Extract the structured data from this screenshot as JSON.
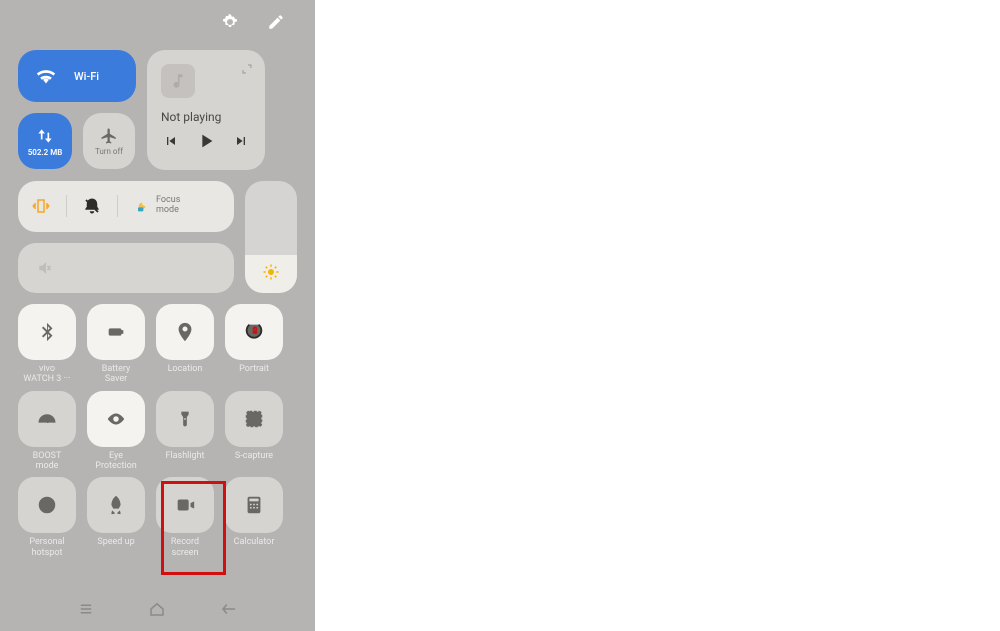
{
  "topbar": {
    "settings_icon": "settings",
    "edit_icon": "edit"
  },
  "wifi": {
    "label": "Wi-Fi"
  },
  "data": {
    "usage": "502.2 MB"
  },
  "airplane": {
    "label": "Turn off"
  },
  "media": {
    "status": "Not playing"
  },
  "modes": {
    "focus_label": "Focus\nmode"
  },
  "tiles": {
    "bluetooth": {
      "label": "vivo\nWATCH 3 ···"
    },
    "battery": {
      "label": "Battery\nSaver"
    },
    "location": {
      "label": "Location"
    },
    "portrait": {
      "label": "Portrait"
    },
    "boost": {
      "label": "BOOST\nmode"
    },
    "eye": {
      "label": "Eye\nProtection"
    },
    "flashlight": {
      "label": "Flashlight"
    },
    "scapture": {
      "label": "S-capture"
    },
    "hotspot": {
      "label": "Personal\nhotspot"
    },
    "speedup": {
      "label": "Speed up"
    },
    "record": {
      "label": "Record\nscreen"
    },
    "calculator": {
      "label": "Calculator"
    }
  }
}
